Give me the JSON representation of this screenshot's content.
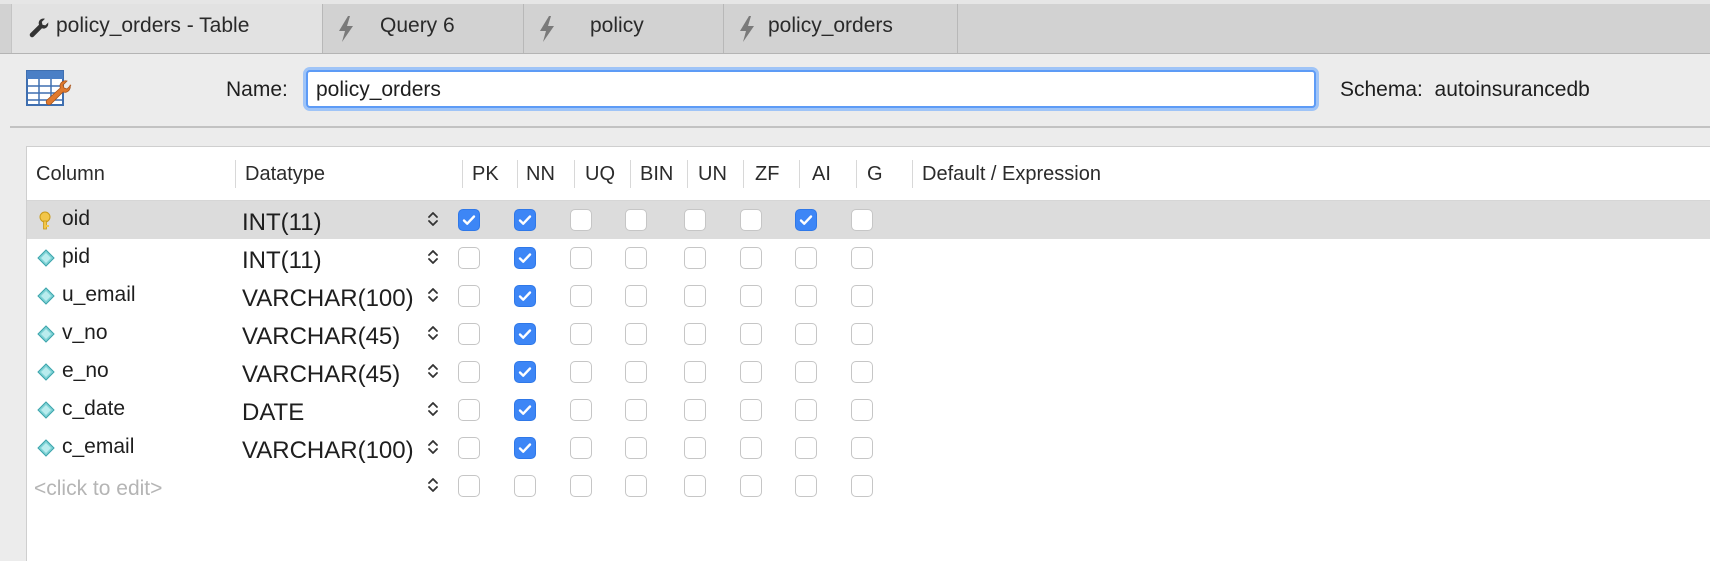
{
  "tabs": [
    {
      "label": "policy_orders - Table",
      "icon": "wrench-icon"
    },
    {
      "label": "Query 6",
      "icon": "bolt-icon"
    },
    {
      "label": "policy",
      "icon": "bolt-icon"
    },
    {
      "label": "policy_orders",
      "icon": "bolt-icon"
    }
  ],
  "header": {
    "name_label": "Name:",
    "name_value": "policy_orders",
    "schema_label": "Schema:  autoinsurancedb"
  },
  "columns_header": {
    "column": "Column",
    "datatype": "Datatype",
    "flags": [
      "PK",
      "NN",
      "UQ",
      "BIN",
      "UN",
      "ZF",
      "AI",
      "G"
    ],
    "default": "Default / Expression"
  },
  "rows": [
    {
      "name": "oid",
      "datatype": "INT(11)",
      "icon": "key-icon",
      "flags": [
        true,
        true,
        false,
        false,
        false,
        false,
        true,
        false
      ]
    },
    {
      "name": "pid",
      "datatype": "INT(11)",
      "icon": "diamond-icon",
      "flags": [
        false,
        true,
        false,
        false,
        false,
        false,
        false,
        false
      ]
    },
    {
      "name": "u_email",
      "datatype": "VARCHAR(100)",
      "icon": "diamond-icon",
      "flags": [
        false,
        true,
        false,
        false,
        false,
        false,
        false,
        false
      ]
    },
    {
      "name": "v_no",
      "datatype": "VARCHAR(45)",
      "icon": "diamond-icon",
      "flags": [
        false,
        true,
        false,
        false,
        false,
        false,
        false,
        false
      ]
    },
    {
      "name": "e_no",
      "datatype": "VARCHAR(45)",
      "icon": "diamond-icon",
      "flags": [
        false,
        true,
        false,
        false,
        false,
        false,
        false,
        false
      ]
    },
    {
      "name": "c_date",
      "datatype": "DATE",
      "icon": "diamond-icon",
      "flags": [
        false,
        true,
        false,
        false,
        false,
        false,
        false,
        false
      ]
    },
    {
      "name": "c_email",
      "datatype": "VARCHAR(100)",
      "icon": "diamond-icon",
      "flags": [
        false,
        true,
        false,
        false,
        false,
        false,
        false,
        false
      ]
    }
  ],
  "new_row_placeholder": "<click to edit>",
  "colors": {
    "accent": "#3d86f6",
    "selected_row": "#dcdcdc",
    "key": "#f2c64a",
    "diamond": "#7fd3d6"
  }
}
